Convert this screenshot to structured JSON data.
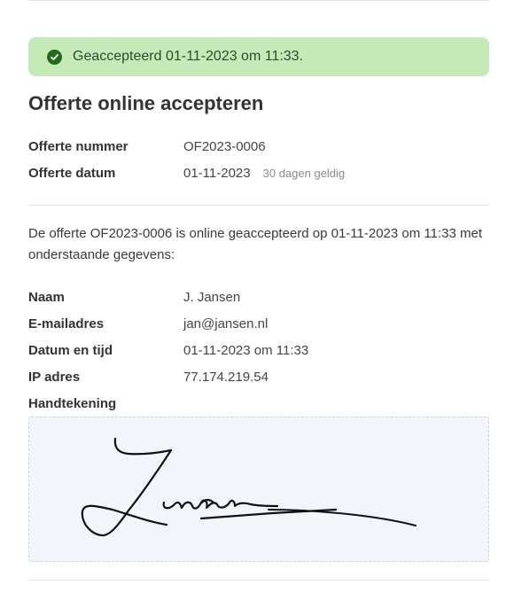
{
  "alert": {
    "text": "Geaccepteerd 01-11-2023 om 11:33.",
    "icon": "check-circle-icon",
    "bg_color": "#c6e9b8",
    "icon_color": "#1f6b1b"
  },
  "heading": "Offerte online accepteren",
  "quote": {
    "number_label": "Offerte nummer",
    "number_value": "OF2023-0006",
    "date_label": "Offerte datum",
    "date_value": "01-11-2023",
    "validity": "30 dagen geldig"
  },
  "statement": "De offerte OF2023-0006 is online geaccepteerd op 01-11-2023 om 11:33 met onderstaande gegevens:",
  "details": {
    "name_label": "Naam",
    "name_value": "J. Jansen",
    "email_label": "E-mailadres",
    "email_value": "jan@jansen.nl",
    "datetime_label": "Datum en tijd",
    "datetime_value": "01-11-2023 om 11:33",
    "ip_label": "IP adres",
    "ip_value": "77.174.219.54",
    "signature_label": "Handtekening"
  },
  "signature": {
    "text": "Jansen"
  }
}
